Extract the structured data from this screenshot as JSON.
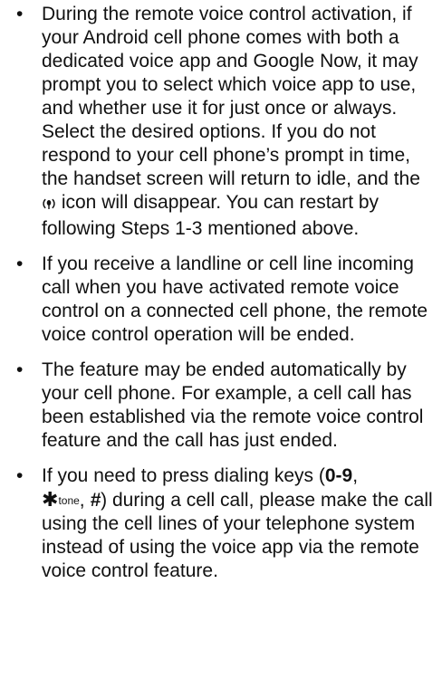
{
  "notes": [
    {
      "part1": "During the remote voice control activation, if your Android cell phone comes with both a dedicated voice app and Google Now, it may prompt you to select which voice app to use, and whether use it for just once or always. Select the desired options. If you do not respond to your cell phone’s prompt in time, the handset screen will return to idle, and the ",
      "icon": "voice-control-icon",
      "part2": " icon will disappear. You can restart by following Steps 1-3 mentioned above."
    },
    {
      "text": "If you receive a landline or cell line incoming call when you have activated remote voice control on a connected cell phone, the remote voice control operation will be ended."
    },
    {
      "text": "The feature may be ended automatically by your cell phone. For example, a cell call has been established via the remote voice control feature and the call has just ended."
    },
    {
      "prefix": "If you need to press dialing keys (",
      "keys_digits": "0-9",
      "comma1": ",",
      "star_key": "✱",
      "tone_label": "tone",
      "comma2": ", ",
      "hash_key": "#",
      "suffix": ") during a cell call, please make the call using the cell lines of your telephone system instead of using the voice app via the remote voice control feature."
    }
  ]
}
